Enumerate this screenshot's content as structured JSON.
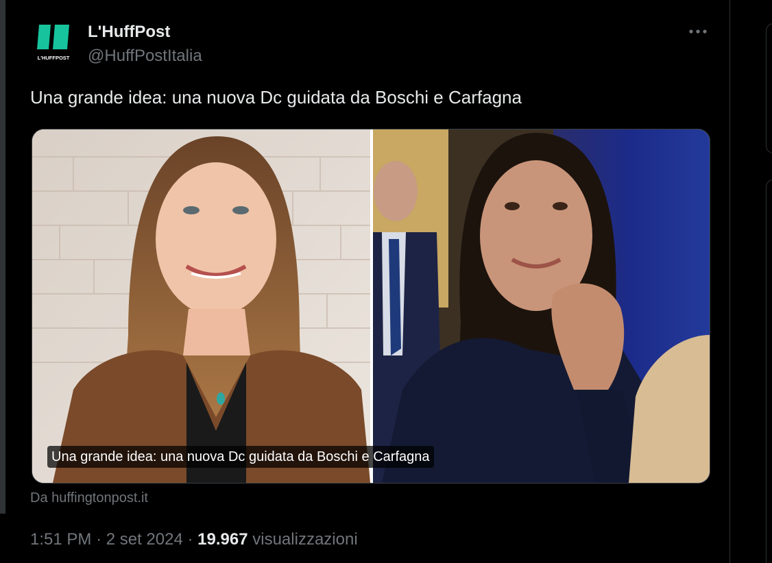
{
  "tweet": {
    "author": {
      "name": "L'HuffPost",
      "handle": "@HuffPostItalia",
      "avatar_label": "L'HUFFPOST",
      "avatar_icon": "huffpost-logo",
      "brand_color": "#17c39d"
    },
    "more_icon": "more-horizontal-icon",
    "text": "Una grande idea: una nuova Dc guidata da Boschi e Carfagna",
    "card": {
      "caption": "Una grande idea: una nuova Dc guidata da Boschi e Carfagna",
      "source": "Da huffingtonpost.it"
    },
    "meta": {
      "time": "1:51 PM",
      "separator": "·",
      "date": "2 set 2024",
      "views_count": "19.967",
      "views_label": "visualizzazioni"
    }
  },
  "colors": {
    "background": "#000000",
    "primary_text": "#e7e9ea",
    "secondary_text": "#71767b",
    "border": "#2f3336"
  }
}
